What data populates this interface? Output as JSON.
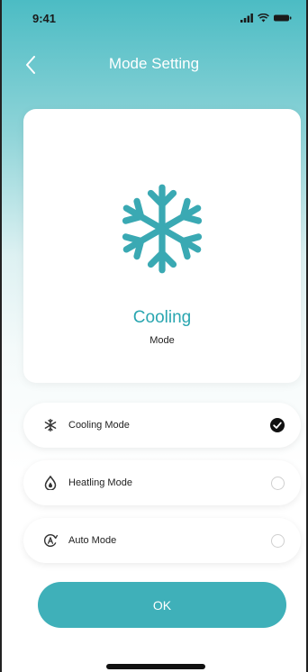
{
  "status_bar": {
    "time": "9:41"
  },
  "header": {
    "title": "Mode Setting",
    "back_icon": "chevron-left-icon"
  },
  "hero": {
    "icon": "snowflake-icon",
    "mode_name": "Cooling",
    "mode_sub": "Mode"
  },
  "options": [
    {
      "label": "Cooling Mode",
      "icon": "snowflake-icon",
      "selected": true
    },
    {
      "label": "Heatling Mode",
      "icon": "heat-drop-icon",
      "selected": false
    },
    {
      "label": "Auto Mode",
      "icon": "auto-mode-icon",
      "selected": false
    }
  ],
  "ok_label": "OK",
  "colors": {
    "accent": "#3fb0b9",
    "hero_icon": "#3aa9b3"
  }
}
